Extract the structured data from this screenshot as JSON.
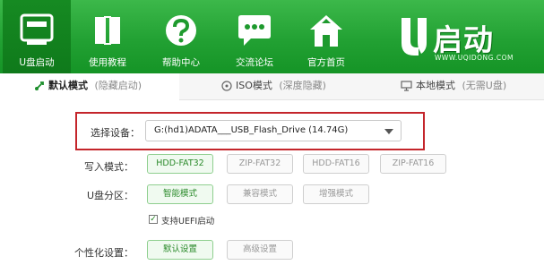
{
  "nav": [
    {
      "label": "U盘启动",
      "icon": "usb-drive-icon"
    },
    {
      "label": "使用教程",
      "icon": "book-icon"
    },
    {
      "label": "帮助中心",
      "icon": "help-icon"
    },
    {
      "label": "交流论坛",
      "icon": "chat-icon"
    },
    {
      "label": "官方首页",
      "icon": "home-icon"
    }
  ],
  "logo": {
    "text": "启动",
    "url": "WWW.UQIDONG.COM"
  },
  "tabs": [
    {
      "label": "默认模式",
      "note": "(隐藏启动)",
      "icon": "usb-mode-icon"
    },
    {
      "label": "ISO模式",
      "note": "(深度隐藏)",
      "icon": "disc-icon"
    },
    {
      "label": "本地模式",
      "note": "(无需U盘)",
      "icon": "monitor-icon"
    }
  ],
  "device": {
    "label": "选择设备：",
    "value": "G:(hd1)ADATA___USB_Flash_Drive (14.74G)"
  },
  "write_mode": {
    "label": "写入模式：",
    "options": [
      "HDD-FAT32",
      "ZIP-FAT32",
      "HDD-FAT16",
      "ZIP-FAT16"
    ],
    "selected": "HDD-FAT32"
  },
  "partition": {
    "label": "U盘分区：",
    "options": [
      "智能模式",
      "兼容模式",
      "增强模式"
    ],
    "selected": "智能模式"
  },
  "uefi": {
    "label": "支持UEFI启动",
    "checked": true
  },
  "personalize": {
    "label": "个性化设置：",
    "options": [
      "默认设置",
      "高级设置"
    ],
    "selected": "默认设置"
  },
  "colors": {
    "header_green": "#22a133",
    "active_nav": "#0f7a1b",
    "highlight_red": "#c4252b",
    "selected_green": "#2a8a2a"
  }
}
